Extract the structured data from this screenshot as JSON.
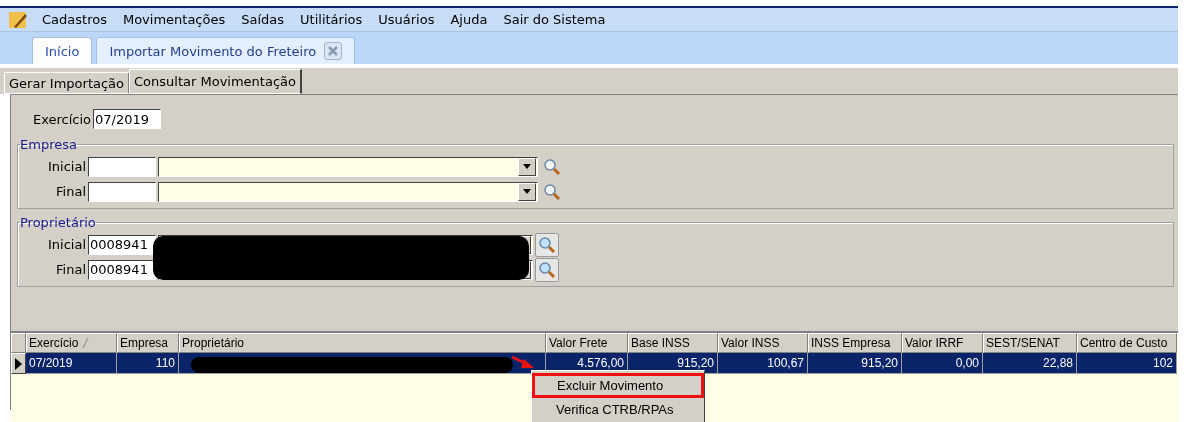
{
  "menu": [
    {
      "label": "Cadastros"
    },
    {
      "label": "Movimentações"
    },
    {
      "label": "Saídas"
    },
    {
      "label": "Utilitários"
    },
    {
      "label": "Usuários"
    },
    {
      "label": "Ajuda"
    },
    {
      "label": "Sair do Sistema"
    }
  ],
  "tabs": [
    {
      "label": "Início",
      "selected": false,
      "closable": false
    },
    {
      "label": "Importar Movimento do Freteiro",
      "selected": true,
      "closable": true
    }
  ],
  "subtabs": [
    {
      "label": "Gerar Importação",
      "selected": false
    },
    {
      "label": "Consultar Movimentação",
      "selected": true
    }
  ],
  "exercicio": {
    "label": "Exercício",
    "value": "07/2019"
  },
  "groups": [
    {
      "title": "Empresa",
      "rows": [
        {
          "label": "Inicial",
          "code": ""
        },
        {
          "label": "Final",
          "code": ""
        }
      ]
    },
    {
      "title": "Proprietário",
      "rows": [
        {
          "label": "Inicial",
          "code": "0008941"
        },
        {
          "label": "Final",
          "code": "0008941"
        }
      ]
    }
  ],
  "table": {
    "columns": [
      {
        "label": "Exercício",
        "sorted": true
      },
      {
        "label": "Empresa",
        "sorted": false
      },
      {
        "label": "Proprietário",
        "sorted": false
      },
      {
        "label": "Valor Frete",
        "sorted": false
      },
      {
        "label": "Base INSS",
        "sorted": false
      },
      {
        "label": "Valor INSS",
        "sorted": false
      },
      {
        "label": "INSS Empresa",
        "sorted": false
      },
      {
        "label": "Valor IRRF",
        "sorted": false
      },
      {
        "label": "SEST/SENAT",
        "sorted": false
      },
      {
        "label": "Centro de Custo",
        "sorted": false
      }
    ],
    "rows": [
      {
        "selected": true,
        "cells": [
          "07/2019",
          "110",
          "",
          "4.576,00",
          "915,20",
          "100,67",
          "915,20",
          "0,00",
          "22,88",
          "102"
        ]
      }
    ]
  },
  "context_menu": [
    {
      "label": "Excluir Movimento",
      "highlighted": true
    },
    {
      "label": "Verifica CTRB/RPAs",
      "highlighted": false
    }
  ]
}
